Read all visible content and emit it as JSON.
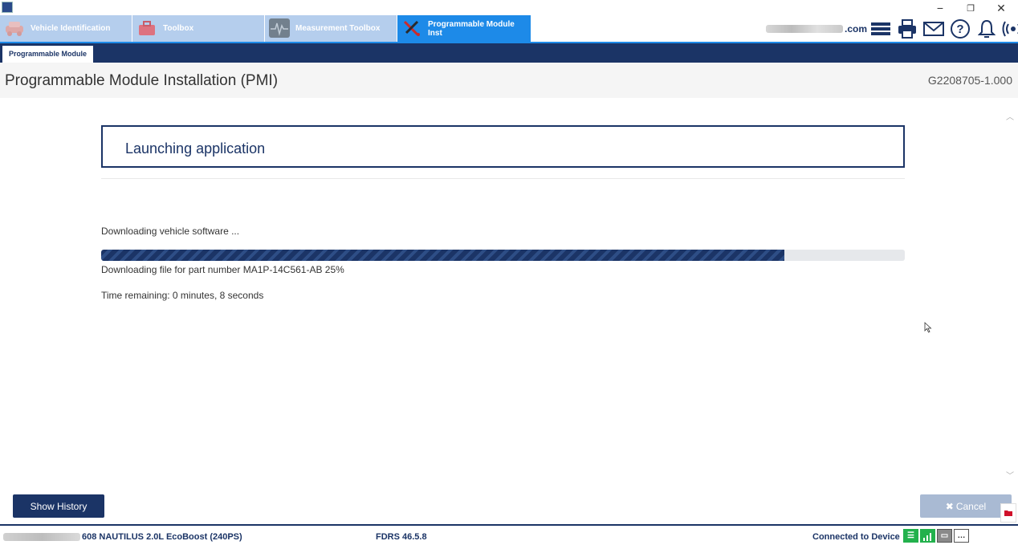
{
  "window": {
    "minimize": "−",
    "restore": "❐",
    "close": "✕"
  },
  "nav_tabs": [
    {
      "label": "Vehicle Identification",
      "icon": "car-icon",
      "color": "#d8a0a0"
    },
    {
      "label": "Toolbox",
      "icon": "toolbox-icon",
      "color": "#d85a6a"
    },
    {
      "label": "Measurement Toolbox",
      "icon": "oscilloscope-icon",
      "color": "#5a6a7a"
    },
    {
      "label": "Programmable Module Inst",
      "icon": "tools-icon",
      "color": "#cc2b2b"
    }
  ],
  "account": {
    "suffix": ".com"
  },
  "top_icons": [
    "menu-icon",
    "printer-icon",
    "mail-icon",
    "help-icon",
    "bell-icon",
    "broadcast-icon"
  ],
  "subtab": {
    "label": "Programmable Module"
  },
  "header": {
    "title": "Programmable Module Installation (PMI)",
    "code": "G2208705-1.000"
  },
  "main": {
    "launch_heading": "Launching application",
    "status": "Downloading vehicle software ...",
    "progress_fraction": 0.85,
    "file_status": "Downloading file for part number MA1P-14C561-AB 25%",
    "time_remaining": "Time remaining: 0 minutes, 8 seconds"
  },
  "buttons": {
    "history": "Show History",
    "cancel": "Cancel",
    "cancel_icon": "✖"
  },
  "statusbar": {
    "vehicle": "608  NAUTILUS 2.0L EcoBoost (240PS)",
    "version": "FDRS 46.5.8",
    "connection": "Connected to Device"
  },
  "colors": {
    "navy": "#1b3466",
    "accent_blue": "#1d8ae8",
    "progress_track": "#e6e8eb",
    "status_green": "#22b14c"
  }
}
